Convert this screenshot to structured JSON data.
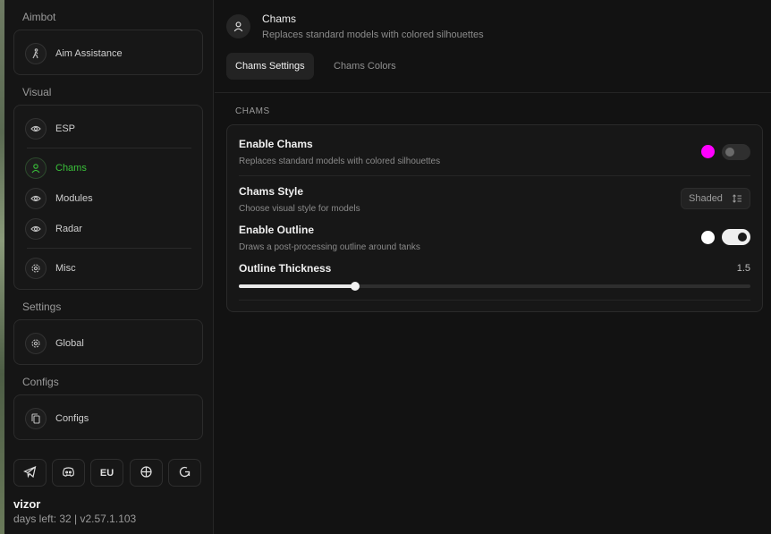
{
  "sidebar": {
    "sections": [
      {
        "title": "Aimbot",
        "items": [
          {
            "label": "Aim Assistance",
            "icon": "person-run-icon"
          }
        ]
      },
      {
        "title": "Visual",
        "items": [
          {
            "label": "ESP",
            "icon": "eye-icon"
          },
          {
            "label": "Chams",
            "icon": "user-icon",
            "active": true
          },
          {
            "label": "Modules",
            "icon": "eye-icon"
          },
          {
            "label": "Radar",
            "icon": "eye-icon"
          },
          {
            "label": "Misc",
            "icon": "gear-icon"
          }
        ]
      },
      {
        "title": "Settings",
        "items": [
          {
            "label": "Global",
            "icon": "gear-icon"
          }
        ]
      },
      {
        "title": "Configs",
        "items": [
          {
            "label": "Configs",
            "icon": "copy-icon"
          }
        ]
      }
    ],
    "footer_buttons": [
      {
        "name": "telegram",
        "icon": "telegram-icon"
      },
      {
        "name": "discord",
        "icon": "discord-icon"
      },
      {
        "name": "region",
        "label": "EU"
      },
      {
        "name": "language",
        "icon": "globe-icon"
      },
      {
        "name": "reload",
        "icon": "reload-icon"
      }
    ],
    "user": {
      "name": "vizor",
      "meta": "days left: 32 | v2.57.1.103"
    }
  },
  "header": {
    "title": "Chams",
    "subtitle": "Replaces standard models with colored silhouettes"
  },
  "tabs": [
    {
      "label": "Chams Settings",
      "active": true
    },
    {
      "label": "Chams Colors",
      "active": false
    }
  ],
  "group": {
    "title": "CHAMS",
    "options": [
      {
        "title": "Enable Chams",
        "desc": "Replaces standard models with colored silhouettes",
        "color": "#ff00ff",
        "enabled": false
      },
      {
        "title": "Chams Style",
        "desc": "Choose visual style for models",
        "value": "Shaded"
      },
      {
        "title": "Enable Outline",
        "desc": "Draws a post-processing outline around tanks",
        "color": "#ffffff",
        "enabled": true
      },
      {
        "title": "Outline Thickness",
        "value": "1.5",
        "slider_fraction": 0.227
      }
    ]
  },
  "colors": {
    "accent_active": "#3ac13a"
  }
}
